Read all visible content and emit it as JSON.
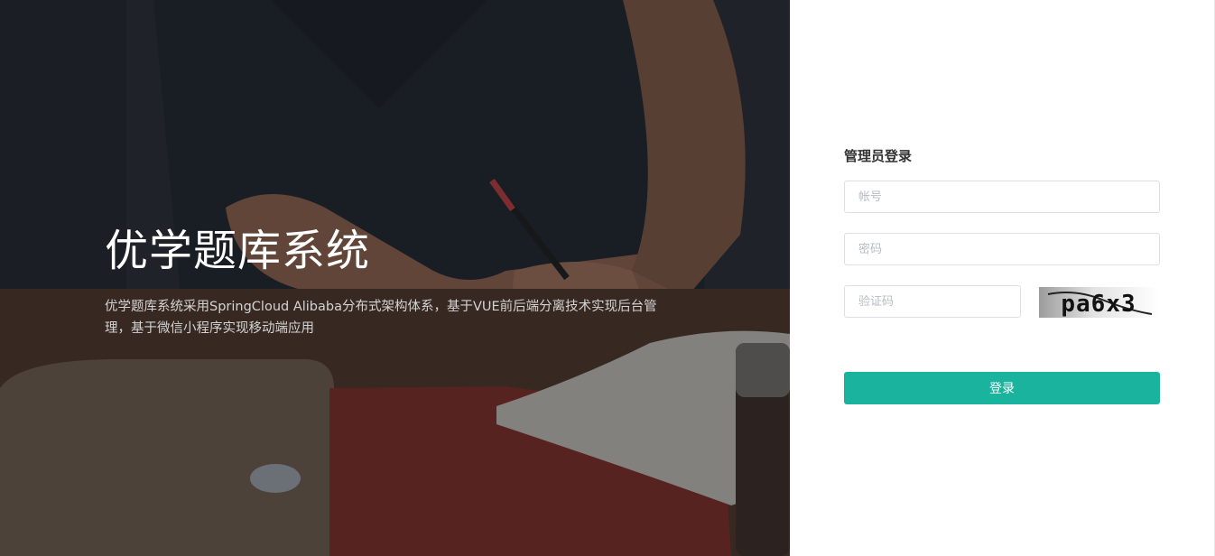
{
  "hero": {
    "title": "优学题库系统",
    "description": "优学题库系统采用SpringCloud Alibaba分布式架构体系，基于VUE前后端分离技术实现后台管理，基于微信小程序实现移动端应用"
  },
  "login": {
    "title": "管理员登录",
    "account_placeholder": "帐号",
    "password_placeholder": "密码",
    "captcha_placeholder": "验证码",
    "captcha_text": "pa6x3",
    "submit_label": "登录"
  },
  "colors": {
    "accent": "#19b39e",
    "panel_bg": "#ffffff",
    "input_border": "#dcdfe6"
  }
}
